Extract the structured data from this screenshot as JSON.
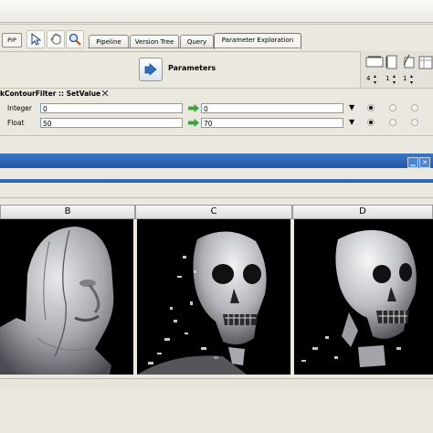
{
  "toolbar": {
    "pip_label": "PIP",
    "pointer_icon": "pointer-icon",
    "hand_icon": "hand-pan-icon",
    "zoom_icon": "zoom-icon",
    "tabs": [
      {
        "label": "Pipeline"
      },
      {
        "label": "Version Tree"
      },
      {
        "label": "Query"
      },
      {
        "label": "Parameter Exploration"
      }
    ]
  },
  "params": {
    "title": "Parameters"
  },
  "filter": {
    "label": "kContourFilter :: SetValue",
    "rows": [
      {
        "label": "Integer",
        "start": "0",
        "end": "0",
        "steps": "4"
      },
      {
        "label": "Float",
        "start": "50",
        "end": "70",
        "steps": "1"
      }
    ]
  },
  "dimension_counters": [
    "4",
    "1",
    "1"
  ],
  "views": [
    {
      "label": "B",
      "image": "skin-surface-render"
    },
    {
      "label": "C",
      "image": "partial-skull-render"
    },
    {
      "label": "D",
      "image": "skull-bone-render"
    }
  ],
  "colors": {
    "titlebar_blue": "#2c62b3",
    "arrow_green": "#3da43d",
    "background": "#ebe8e0"
  }
}
